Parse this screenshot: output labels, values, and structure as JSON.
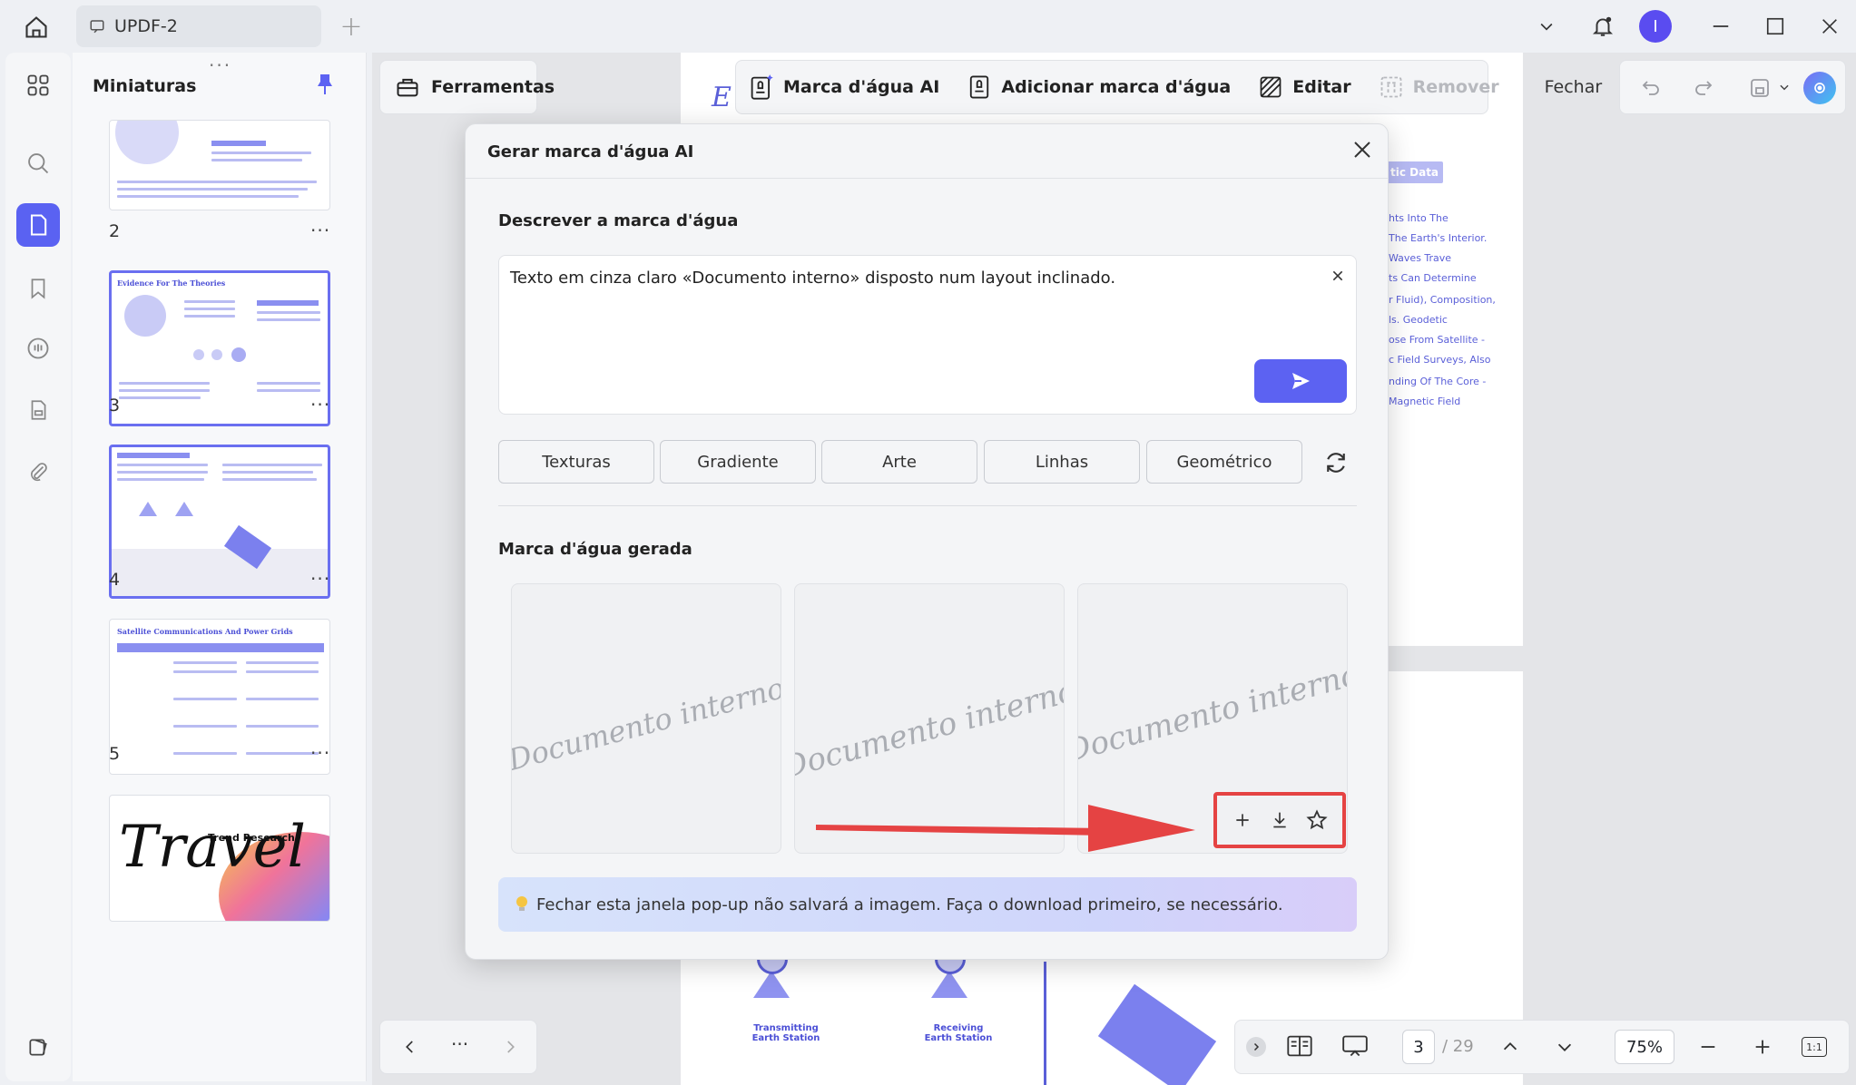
{
  "titlebar": {
    "tab_title": "UPDF-2",
    "avatar_initial": "I"
  },
  "thumbnails": {
    "title": "Miniaturas",
    "pages": [
      {
        "number": "2"
      },
      {
        "number": "3",
        "heading": "Evidence For The Theories"
      },
      {
        "number": "4"
      },
      {
        "number": "5",
        "heading": "Satellite Communications And Power Grids"
      },
      {
        "number": "",
        "heading": "Trend Research"
      }
    ],
    "more_label": "···"
  },
  "toolbar": {
    "tools_label": "Ferramentas",
    "ai_watermark": "Marca d'água AI",
    "add_watermark": "Adicionar marca d'água",
    "edit": "Editar",
    "remove": "Remover",
    "close": "Fechar"
  },
  "document": {
    "tag": "tic Data",
    "side_lines": [
      "hts Into The",
      "The Earth's Interior.",
      "Waves Trave",
      "ts Can Determine",
      "r Fluid), Composition,",
      "ls. Geodetic",
      "ose From Satellite -",
      "c Field Surveys, Also",
      "nding Of The Core -",
      "Magnetic Field"
    ],
    "station_1": "Transmitting\nEarth Station",
    "station_2": "Receiving\nEarth Station",
    "title_glyph": "E"
  },
  "modal": {
    "title": "Gerar marca d'água AI",
    "describe_label": "Descrever a marca d'água",
    "prompt_text": "Texto em cinza claro «Documento interno» disposto num layout inclinado.",
    "styles": [
      "Texturas",
      "Gradiente",
      "Arte",
      "Linhas",
      "Geométrico"
    ],
    "generated_label": "Marca d'água gerada",
    "results": [
      {
        "text": "Documento interno"
      },
      {
        "text": "Documento interno"
      },
      {
        "text": "Documento interno"
      }
    ],
    "notice": "Fechar esta janela pop-up não salvará a imagem. Faça o download primeiro, se necessário."
  },
  "navigation": {
    "current_page": "3",
    "total_pages": "/ 29",
    "zoom": "75%",
    "fit_label": "1:1",
    "more": "···"
  },
  "colors": {
    "accent": "#5c62f2",
    "highlight": "#e54343"
  }
}
